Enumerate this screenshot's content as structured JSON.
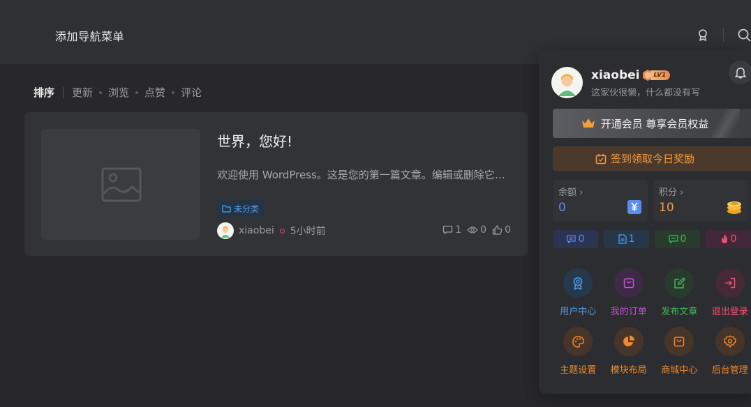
{
  "header": {
    "nav_add_label": "添加导航菜单"
  },
  "sort": {
    "label": "排序",
    "options": [
      "更新",
      "浏览",
      "点赞",
      "评论"
    ]
  },
  "post": {
    "title": "世界，您好!",
    "excerpt": "欢迎使用 WordPress。这是您的第一篇文章。编辑或删除它，然后开始写作吧！",
    "category": "未分类",
    "author": "xiaobei",
    "time": "5小时前",
    "comments": "1",
    "views": "0",
    "likes": "0"
  },
  "panel": {
    "username": "xiaobei",
    "level": "LV1",
    "signature": "这家伙很懒，什么都没有写",
    "vip_label": "开通会员 尊享会员权益",
    "signin_label": "签到领取今日奖励",
    "balance": {
      "label": "余额",
      "value": "0"
    },
    "points": {
      "label": "积分",
      "value": "10"
    },
    "counts": [
      {
        "icon": "posts-icon",
        "value": "0",
        "color": "#5b8cf0",
        "bg": "#2b3450"
      },
      {
        "icon": "file-icon",
        "value": "1",
        "color": "#4f9ee8",
        "bg": "#27374a"
      },
      {
        "icon": "comment-icon",
        "value": "0",
        "color": "#3fb85c",
        "bg": "#283b2e"
      },
      {
        "icon": "fire-icon",
        "value": "0",
        "color": "#f0506e",
        "bg": "#43283a"
      }
    ],
    "actions": [
      {
        "label": "用户中心",
        "icon": "award-icon",
        "color": "#4f9ee8",
        "bg": "#27384d"
      },
      {
        "label": "我的订单",
        "icon": "bag-icon",
        "color": "#c84fd6",
        "bg": "#3e2a46"
      },
      {
        "label": "发布文章",
        "icon": "edit-icon",
        "color": "#3fb85c",
        "bg": "#283c2d"
      },
      {
        "label": "退出登录",
        "icon": "logout-icon",
        "color": "#f0506e",
        "bg": "#452a35"
      },
      {
        "label": "主题设置",
        "icon": "palette-icon",
        "color": "#f08a2c",
        "bg": "#48352a"
      },
      {
        "label": "模块布局",
        "icon": "pie-icon",
        "color": "#f08a2c",
        "bg": "#48352a"
      },
      {
        "label": "商城中心",
        "icon": "shop-icon",
        "color": "#f08a2c",
        "bg": "#48352a"
      },
      {
        "label": "后台管理",
        "icon": "gear-icon",
        "color": "#f08a2c",
        "bg": "#48352a"
      }
    ]
  },
  "colors": {
    "accent_blue": "#4f9ee8",
    "balance_value": "#5b8cf0",
    "points_value": "#f39c3c",
    "signin": "#f39c3c"
  }
}
